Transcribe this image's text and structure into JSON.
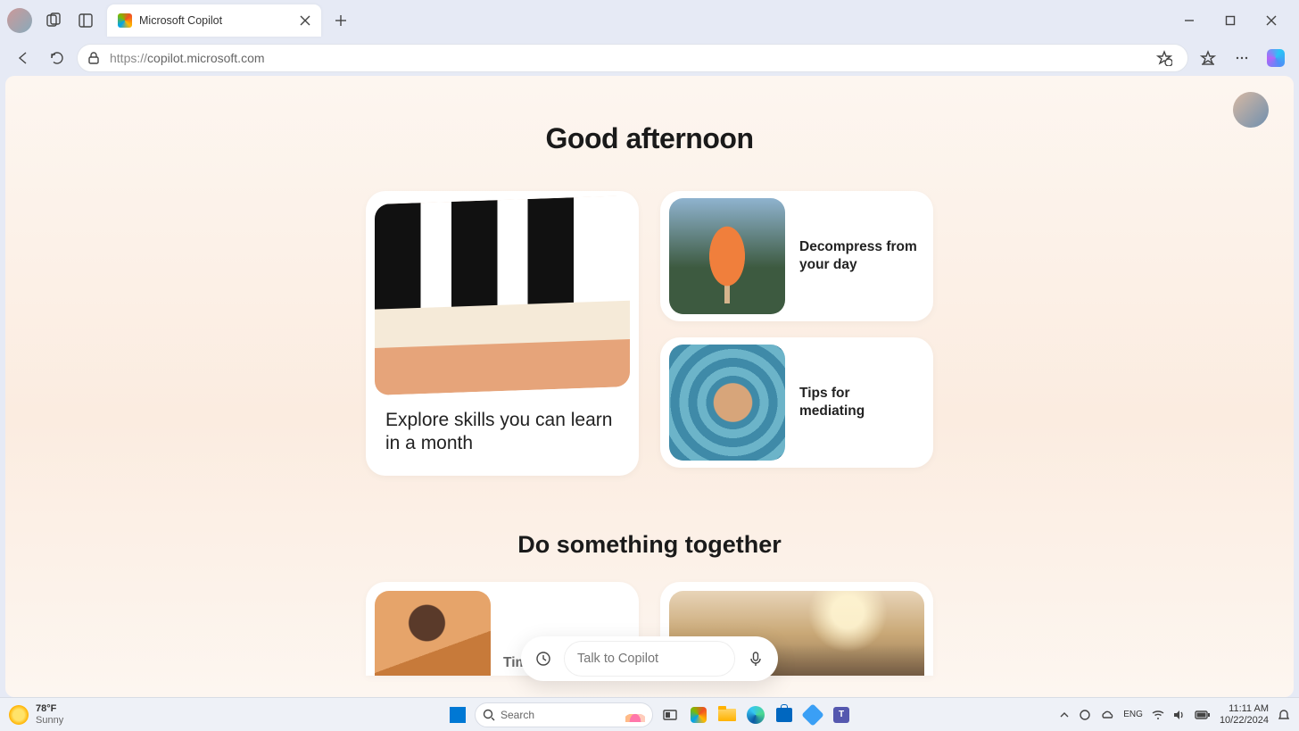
{
  "browser": {
    "tab_title": "Microsoft Copilot",
    "url_display": "https://copilot.microsoft.com",
    "url_proto": "https://",
    "url_rest": "copilot.microsoft.com"
  },
  "page": {
    "greeting": "Good afternoon",
    "cards": {
      "explore": "Explore skills you can learn in a month",
      "decompress": "Decompress from your day",
      "mediate": "Tips for mediating"
    },
    "subhead": "Do something together",
    "row2": {
      "time": "Tim"
    },
    "talk_placeholder": "Talk to Copilot"
  },
  "taskbar": {
    "temp": "78°F",
    "cond": "Sunny",
    "search_placeholder": "Search",
    "time": "11:11 AM",
    "date": "10/22/2024"
  }
}
